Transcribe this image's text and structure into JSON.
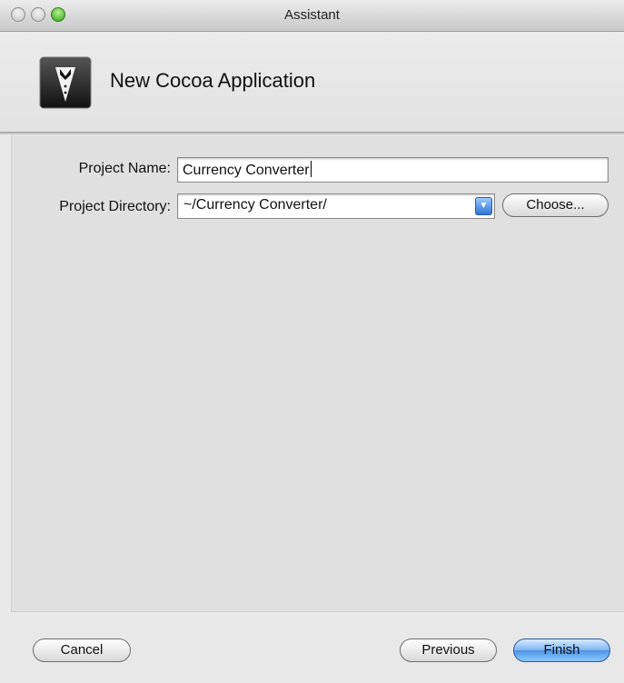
{
  "window": {
    "title": "Assistant"
  },
  "header": {
    "title": "New Cocoa Application",
    "icon": "tuxedo-icon"
  },
  "form": {
    "project_name_label": "Project Name:",
    "project_name_value": "Currency Converter",
    "project_directory_label": "Project Directory:",
    "project_directory_value": "~/Currency Converter/",
    "choose_label": "Choose..."
  },
  "footer": {
    "cancel_label": "Cancel",
    "previous_label": "Previous",
    "finish_label": "Finish"
  },
  "colors": {
    "accent": "#4d93e3",
    "zoom_button": "#2c9e15"
  }
}
